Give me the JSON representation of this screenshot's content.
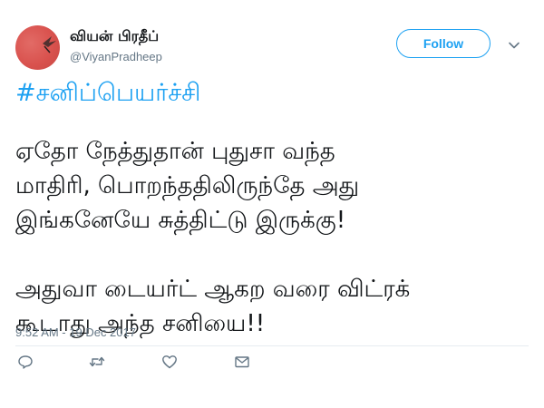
{
  "user": {
    "display_name": "வியன் பிரதீப்",
    "handle": "@ViyanPradheep"
  },
  "follow_button": {
    "label": "Follow"
  },
  "tweet": {
    "hashtag": "#சனிப்பெயர்ச்சி",
    "lines": [
      "ஏதோ நேத்துதான் புதுசா வந்த",
      "மாதிரி, பொறந்ததிலிருந்தே அது",
      "இங்கனேயே சுத்திட்டு இருக்கு!",
      "அதுவா டையர்ட் ஆகற வரை விட்ரக்",
      "கூடாது அந்த சனியை!!"
    ],
    "timestamp": "9:52 AM - 19 Dec 2017"
  },
  "actions": [
    {
      "icon": "reply-icon"
    },
    {
      "icon": "retweet-icon"
    },
    {
      "icon": "like-icon"
    },
    {
      "icon": "direct-message-icon"
    }
  ],
  "colors": {
    "accent": "#1da1f2",
    "secondary_text": "#657786",
    "avatar": "#d9524e"
  }
}
